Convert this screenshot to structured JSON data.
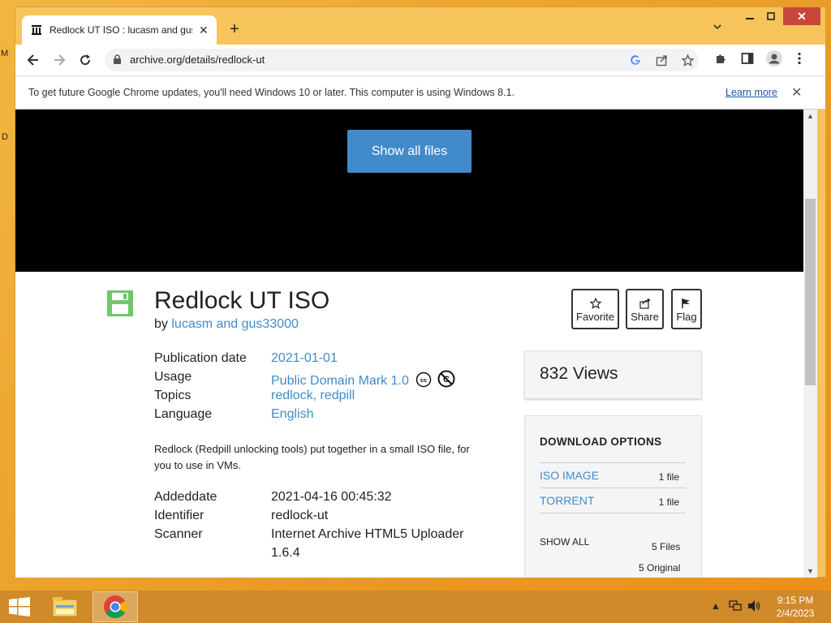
{
  "desktop": {
    "fragments": [
      "M",
      "D"
    ]
  },
  "browser": {
    "tab_title": "Redlock UT ISO : lucasm and gus",
    "url": "archive.org/details/redlock-ut",
    "infobar": {
      "message": "To get future Google Chrome updates, you'll need Windows 10 or later. This computer is using Windows 8.1.",
      "link": "Learn more"
    }
  },
  "page": {
    "show_all_files": "Show all files",
    "title": "Redlock UT ISO",
    "by_prefix": "by",
    "author": "lucasm and gus33000",
    "actions": {
      "favorite": "Favorite",
      "share": "Share",
      "flag": "Flag"
    },
    "metadata": {
      "publication_date_label": "Publication date",
      "publication_date": "2021-01-01",
      "usage_label": "Usage",
      "usage": "Public Domain Mark 1.0",
      "topics_label": "Topics",
      "topic_1": "redlock",
      "topic_2": "redpill",
      "language_label": "Language",
      "language": "English"
    },
    "description": "Redlock (Redpill unlocking tools) put together in a small ISO file, for you to use in VMs.",
    "details": {
      "addeddate_label": "Addeddate",
      "addeddate": "2021-04-16 00:45:32",
      "identifier_label": "Identifier",
      "identifier": "redlock-ut",
      "scanner_label": "Scanner",
      "scanner_line1": "Internet Archive HTML5 Uploader",
      "scanner_line2": "1.6.4"
    },
    "views": "832 Views",
    "download": {
      "heading": "DOWNLOAD OPTIONS",
      "options": [
        {
          "name": "ISO IMAGE",
          "count": "1 file"
        },
        {
          "name": "TORRENT",
          "count": "1 file"
        }
      ],
      "show_all": "SHOW ALL",
      "files_count": "5 Files",
      "original_count": "5 Original"
    }
  },
  "taskbar": {
    "time": "9:15 PM",
    "date": "2/4/2023"
  },
  "colors": {
    "link": "#428bca",
    "button": "#428bca",
    "chrome_frame": "#f7c45b",
    "taskbar": "#d08a2a"
  }
}
